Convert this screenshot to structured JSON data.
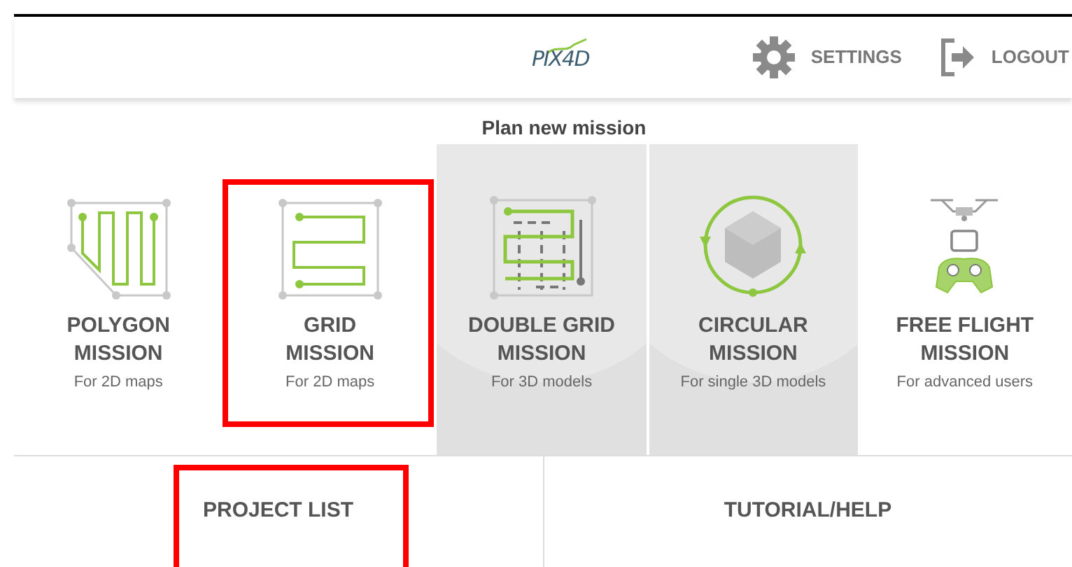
{
  "header": {
    "logo": "PIX4D",
    "actions": [
      {
        "kind": "settings",
        "label": "SETTINGS"
      },
      {
        "kind": "logout",
        "label": "LOGOUT"
      }
    ]
  },
  "heading": "Plan new mission",
  "missions": [
    {
      "kind": "polygon",
      "title": "POLYGON",
      "title_2": "MISSION",
      "subtitle": "For 2D maps",
      "shaded": false,
      "outlined": false
    },
    {
      "kind": "grid",
      "title": "GRID",
      "title_2": "MISSION",
      "subtitle": "For 2D maps",
      "shaded": false,
      "outlined": true
    },
    {
      "kind": "double_grid",
      "title": "DOUBLE GRID",
      "title_2": "MISSION",
      "subtitle": "For 3D models",
      "shaded": true,
      "outlined": false
    },
    {
      "kind": "circular",
      "title": "CIRCULAR",
      "title_2": "MISSION",
      "subtitle": "For single 3D models",
      "shaded": true,
      "outlined": false
    },
    {
      "kind": "free_flight",
      "title": "FREE FLIGHT",
      "title_2": "MISSION",
      "subtitle": "For advanced users",
      "shaded": false,
      "outlined": false
    }
  ],
  "footer": [
    {
      "label": "PROJECT LIST",
      "outlined": true
    },
    {
      "label": "TUTORIAL/HELP",
      "outlined": false
    }
  ]
}
